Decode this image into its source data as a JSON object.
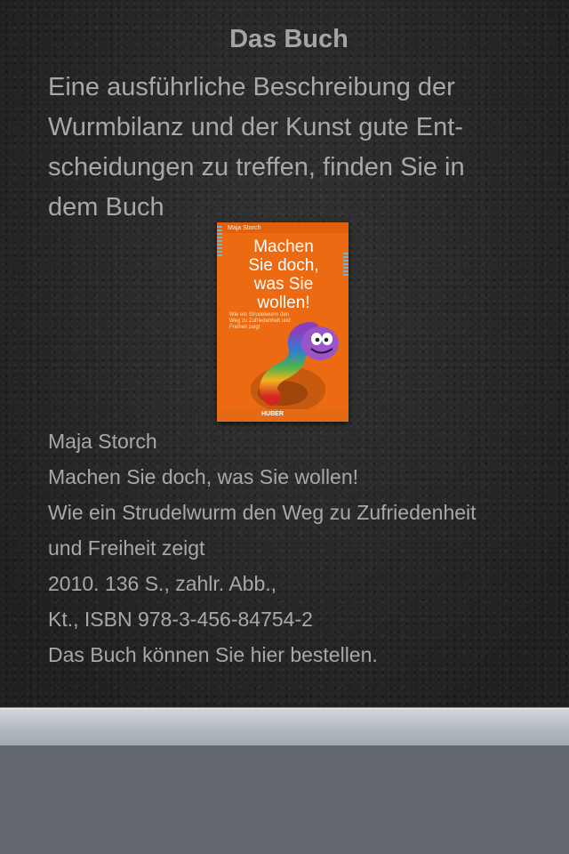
{
  "page": {
    "title": "Das Buch",
    "intro_lines": [
      "Eine ausführliche Beschreibung der",
      "Wurmbilanz und der Kunst gute Ent-",
      "scheidungen zu treffen, finden Sie in",
      "dem Buch"
    ]
  },
  "cover": {
    "author": "Maja Storch",
    "title_lines": [
      "Machen",
      "Sie doch,",
      "was Sie",
      "wollen!"
    ],
    "subtitle": "Wie ein Strudelwurm den Weg zu Zufriedenheit und Freiheit zeigt",
    "publisher": "HUBER"
  },
  "book_info": {
    "author": "Maja Storch",
    "title": "Machen Sie doch, was Sie wollen!",
    "subtitle_line1": "Wie ein Strudelwurm den Weg zu Zufriedenheit",
    "subtitle_line2": "und Freiheit zeigt",
    "publication": "2010. 136 S., zahlr. Abb.,",
    "isbn": "Kt., ISBN 978-3-456-84754-2",
    "order_text": "Das Buch können Sie hier bestellen."
  }
}
